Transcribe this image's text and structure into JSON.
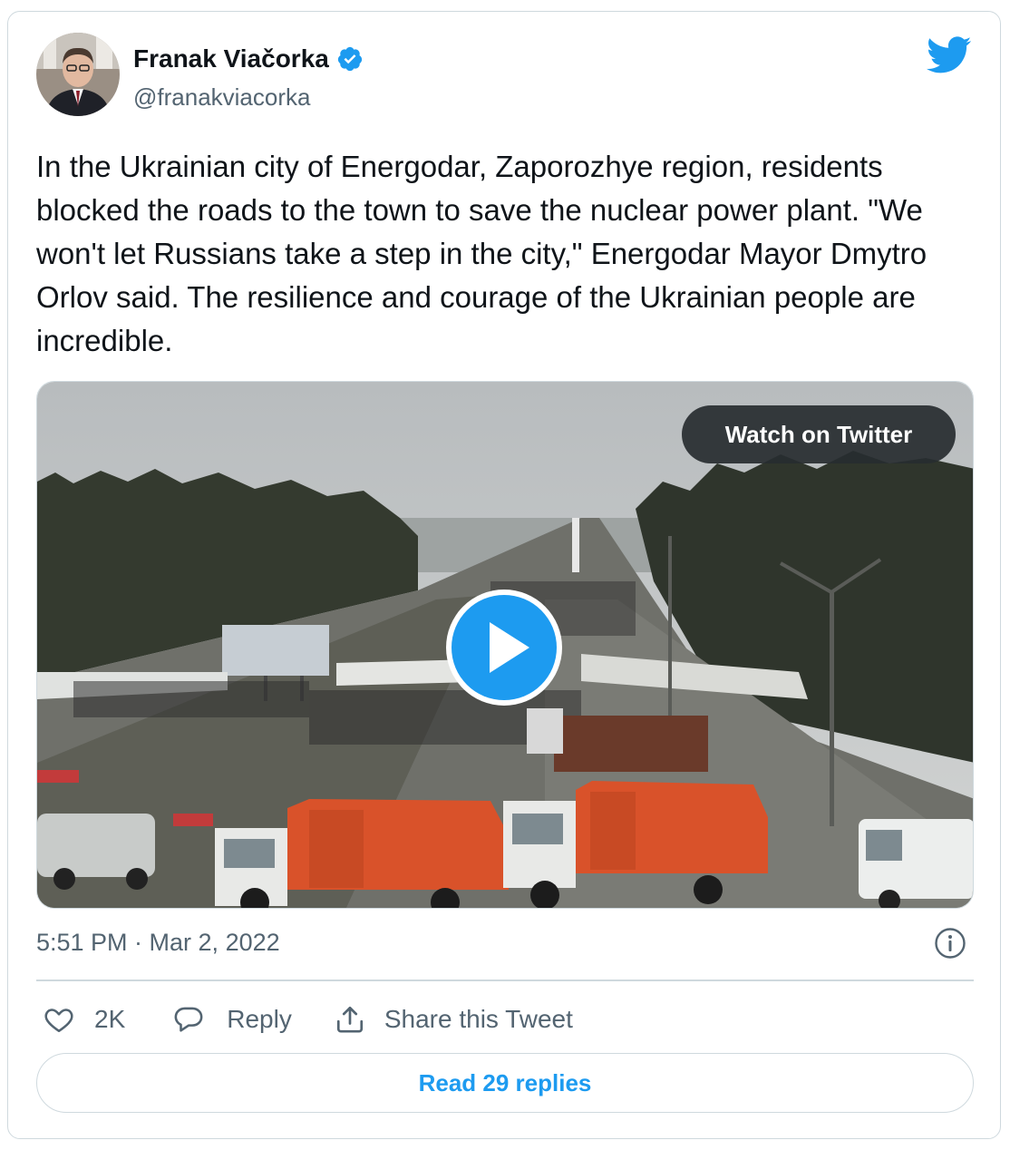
{
  "author": {
    "name": "Franak Viačorka",
    "handle": "@franakviacorka",
    "verified": true
  },
  "tweet": {
    "text": "In the Ukrainian city of Energodar, Zaporozhye region, residents blocked the roads to the town to save the nuclear power plant. \"We won't let Russians take a step in the city,\" Energodar Mayor Dmytro Orlov said. The resilience and courage of the Ukrainian people are incredible.",
    "timestamp": "5:51 PM · Mar 2, 2022"
  },
  "media": {
    "watch_label": "Watch on Twitter"
  },
  "actions": {
    "like_count": "2K",
    "reply_label": "Reply",
    "share_label": "Share this Tweet"
  },
  "footer": {
    "read_replies_label": "Read 29 replies"
  },
  "icons": {
    "brand": "twitter-bird-icon",
    "verified": "verified-badge-icon",
    "info": "info-icon",
    "like": "heart-icon",
    "reply": "reply-bubble-icon",
    "share": "share-icon",
    "play": "play-icon"
  },
  "colors": {
    "brand_blue": "#1d9bf0",
    "text_primary": "#0f1419",
    "text_secondary": "#536471",
    "border": "#cfd9de",
    "truck_orange": "#d9522a"
  }
}
